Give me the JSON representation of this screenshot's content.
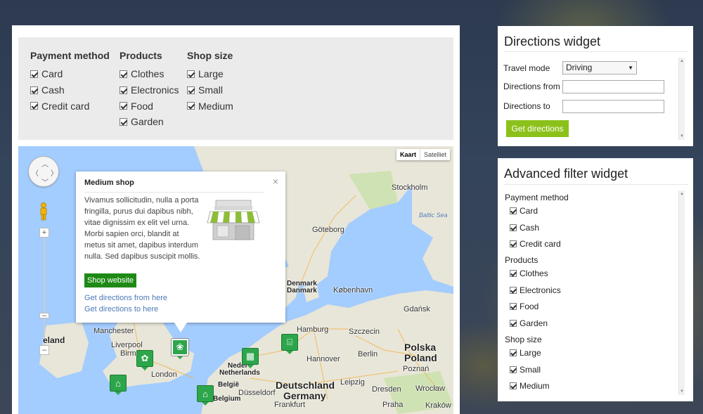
{
  "filters": {
    "groups": [
      {
        "title": "Payment method",
        "options": [
          "Card",
          "Cash",
          "Credit card"
        ]
      },
      {
        "title": "Products",
        "options": [
          "Clothes",
          "Electronics",
          "Food",
          "Garden"
        ]
      },
      {
        "title": "Shop size",
        "options": [
          "Large",
          "Small",
          "Medium"
        ]
      }
    ]
  },
  "map": {
    "type_buttons": {
      "map": "Kaart",
      "satellite": "Satelliet"
    },
    "labels": {
      "stockholm": "Stockholm",
      "goteborg": "Göteborg",
      "baltic": "Baltic Sea",
      "denmark1": "Denmark",
      "denmark2": "Danmark",
      "kobenhavn": "København",
      "gdansk": "Gdańsk",
      "hamburg": "Hamburg",
      "szczecin": "Szczecin",
      "manchester": "Manchester",
      "liverpool": "Liverpool",
      "ireland": "eland",
      "birmingham": "Birmi",
      "london": "London",
      "netherlands": "Netherlands",
      "nederland": "Neder",
      "belgie": "België",
      "belgium": "Belgium",
      "deutschland": "Deutschland",
      "germany": "Germany",
      "polska": "Polska",
      "poland": "Poland",
      "poznan": "Poznań",
      "wroclaw": "Wrocław",
      "berlin": "Berlin",
      "krakow": "Kraków",
      "leipzig": "Leipzig",
      "dresden": "Dresden",
      "hannover": "Hannover",
      "praha": "Praha",
      "dusseldorf": "Düsseldorf",
      "frankfurt": "Frankfurt"
    }
  },
  "info_window": {
    "title": "Medium shop",
    "text": "Vivamus sollicitudin, nulla a porta fringilla, purus dui dapibus nibh, vitae dignissim ex elit vel urna. Morbi sapien orci, blandit at metus sit amet, dapibus interdum nulla. Sed dapibus suscipit mollis.",
    "button": "Shop website",
    "link_from": "Get directions from here",
    "link_to": "Get directions to here",
    "close": "×"
  },
  "directions_widget": {
    "title": "Directions widget",
    "travel_mode_label": "Travel mode",
    "travel_mode_value": "Driving",
    "from_label": "Directions from",
    "to_label": "Directions to",
    "button": "Get directions"
  },
  "advanced_widget": {
    "title": "Advanced filter widget",
    "groups": [
      {
        "title": "Payment method",
        "options": [
          "Card",
          "Cash",
          "Credit card"
        ]
      },
      {
        "title": "Products",
        "options": [
          "Clothes",
          "Electronics",
          "Food",
          "Garden"
        ]
      },
      {
        "title": "Shop size",
        "options": [
          "Large",
          "Small",
          "Medium"
        ]
      }
    ]
  },
  "colors": {
    "accent_green": "#8cc11a",
    "button_green": "#1e8a15",
    "marker_green": "#2da64b",
    "link_blue": "#4a79b6"
  }
}
